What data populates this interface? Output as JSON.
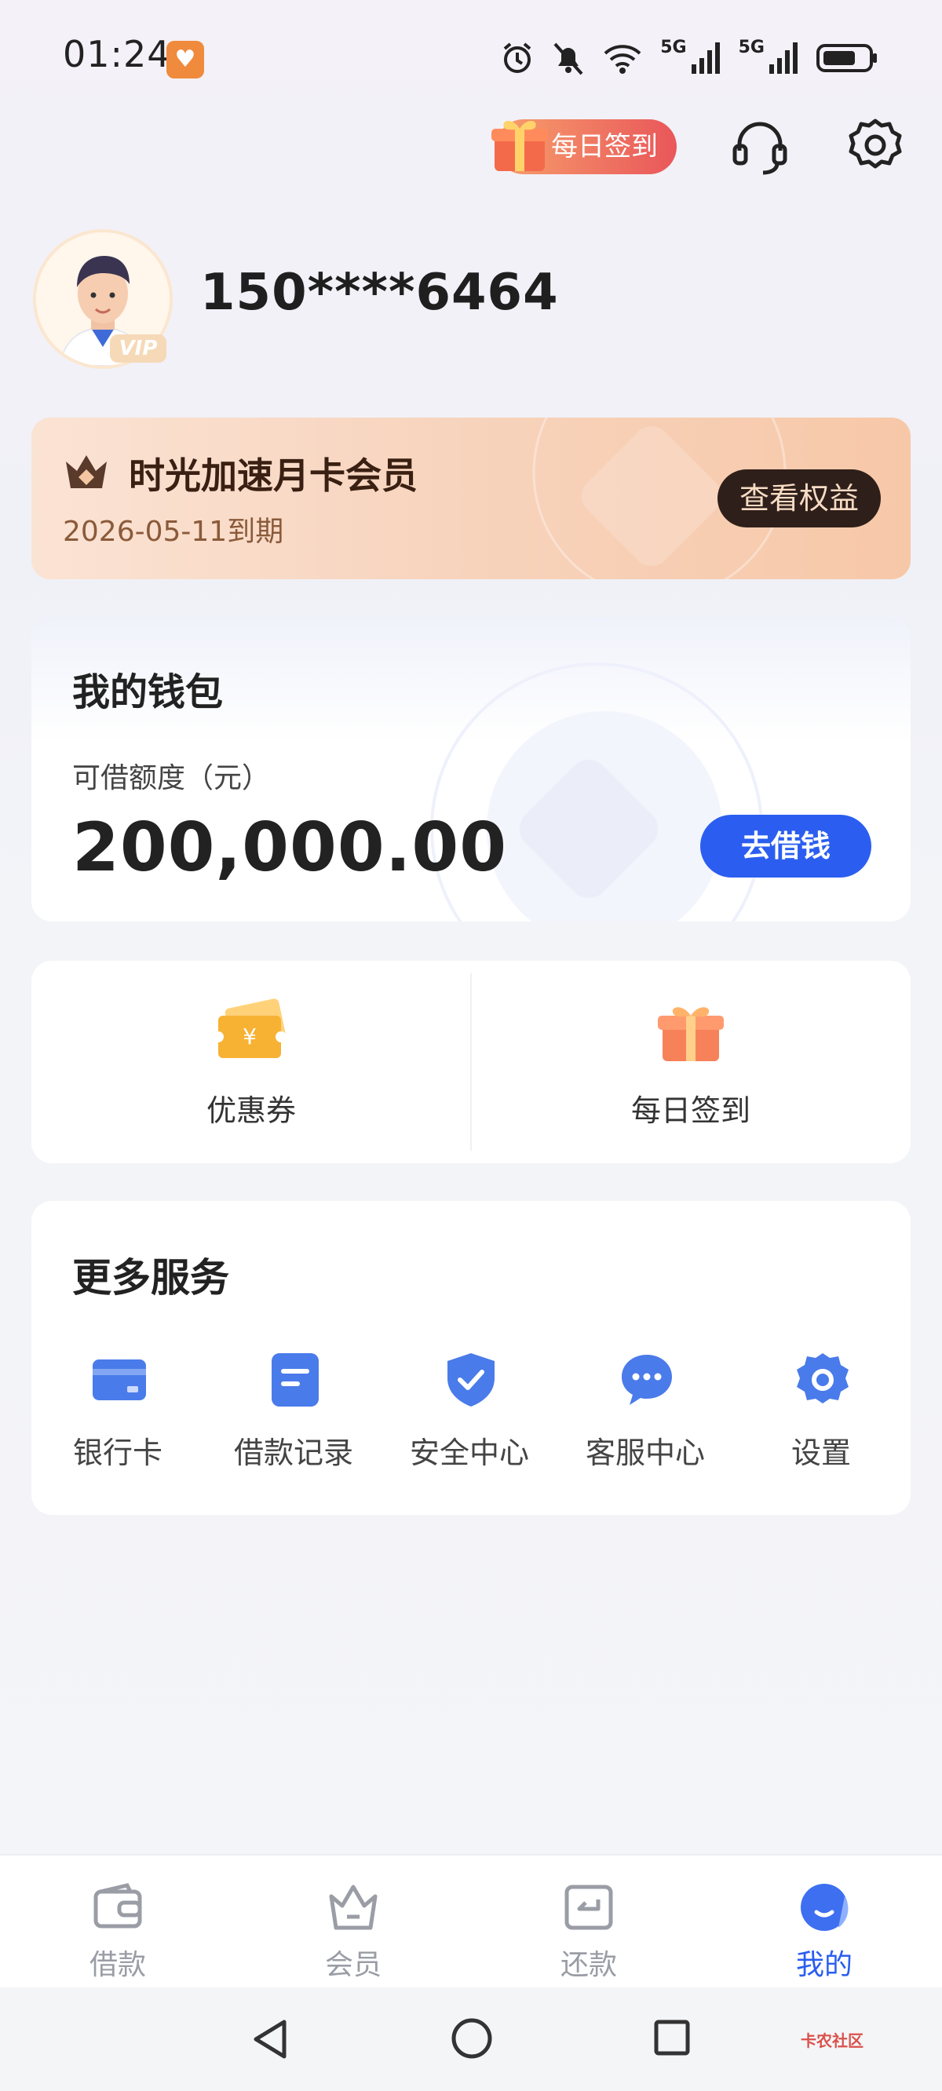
{
  "status_bar": {
    "time": "01:24",
    "network_1": "5G",
    "network_2": "5G"
  },
  "header": {
    "checkin_label": "每日签到"
  },
  "profile": {
    "phone": "150****6464",
    "vip_label": "VIP"
  },
  "membership": {
    "title": "时光加速月卡会员",
    "expire": "2026-05-11到期",
    "rights_button": "查看权益"
  },
  "wallet": {
    "title": "我的钱包",
    "subtitle": "可借额度（元）",
    "amount": "200,000.00",
    "borrow_button": "去借钱"
  },
  "quick": [
    {
      "label": "优惠券",
      "icon": "coupon-icon"
    },
    {
      "label": "每日签到",
      "icon": "gift-icon"
    }
  ],
  "services": {
    "title": "更多服务",
    "items": [
      {
        "label": "银行卡",
        "icon": "bank-card-icon"
      },
      {
        "label": "借款记录",
        "icon": "record-icon"
      },
      {
        "label": "安全中心",
        "icon": "shield-icon"
      },
      {
        "label": "客服中心",
        "icon": "chat-icon"
      },
      {
        "label": "设置",
        "icon": "gear-icon"
      }
    ]
  },
  "tabs": [
    {
      "label": "借款",
      "icon": "wallet-icon",
      "active": false
    },
    {
      "label": "会员",
      "icon": "crown-icon",
      "active": false
    },
    {
      "label": "还款",
      "icon": "repay-icon",
      "active": false
    },
    {
      "label": "我的",
      "icon": "profile-icon",
      "active": true
    }
  ],
  "watermark": "卡农社区",
  "colors": {
    "accent": "#2b5ef0",
    "member_dark": "#2f1f1a",
    "checkin_gradient_end": "#e9565a"
  }
}
